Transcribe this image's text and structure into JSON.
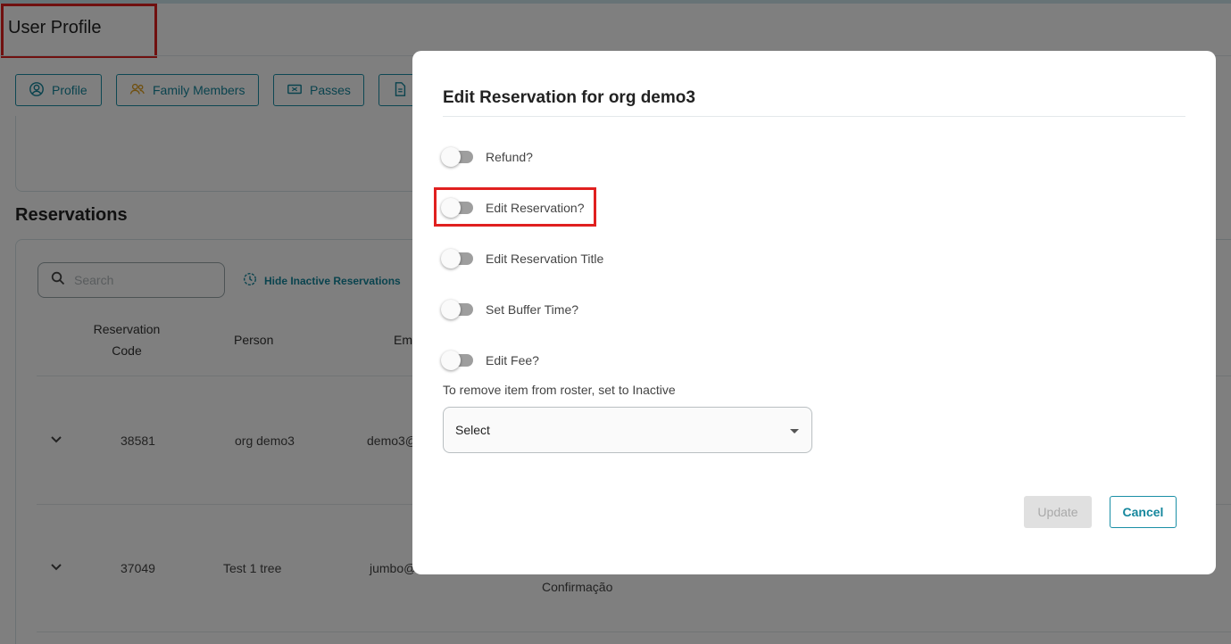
{
  "page": {
    "title": "User Profile",
    "tabs": [
      {
        "label": "Profile",
        "icon": "user-circle-icon"
      },
      {
        "label": "Family Members",
        "icon": "users-icon"
      },
      {
        "label": "Passes",
        "icon": "ticket-icon"
      },
      {
        "label": "",
        "icon": "document-icon"
      }
    ],
    "reservations_title": "Reservations",
    "search": {
      "placeholder": "Search",
      "value": ""
    },
    "hide_inactive_label": "Hide Inactive Reservations",
    "table": {
      "headers": {
        "code": "Reservation Code",
        "person": "Person",
        "email": "Em"
      },
      "rows": [
        {
          "code": "38581",
          "person": "org demo3",
          "email": "demo3@",
          "extra": ""
        },
        {
          "code": "37049",
          "person": "Test 1 tree",
          "email": "jumbo@",
          "extra": "Confirmação"
        }
      ]
    }
  },
  "modal": {
    "title": "Edit Reservation for org demo3",
    "toggles": [
      {
        "label": "Refund?",
        "checked": false
      },
      {
        "label": "Edit Reservation?",
        "checked": false
      },
      {
        "label": "Edit Reservation Title",
        "checked": false
      },
      {
        "label": "Set Buffer Time?",
        "checked": false
      },
      {
        "label": "Edit Fee?",
        "checked": false
      }
    ],
    "roster_label": "To remove item from roster, set to Inactive",
    "select_value": "Select",
    "update_label": "Update",
    "cancel_label": "Cancel"
  },
  "colors": {
    "accent": "#15879d",
    "highlight": "#e0201f",
    "disabled_bg": "#e0e0e0"
  }
}
